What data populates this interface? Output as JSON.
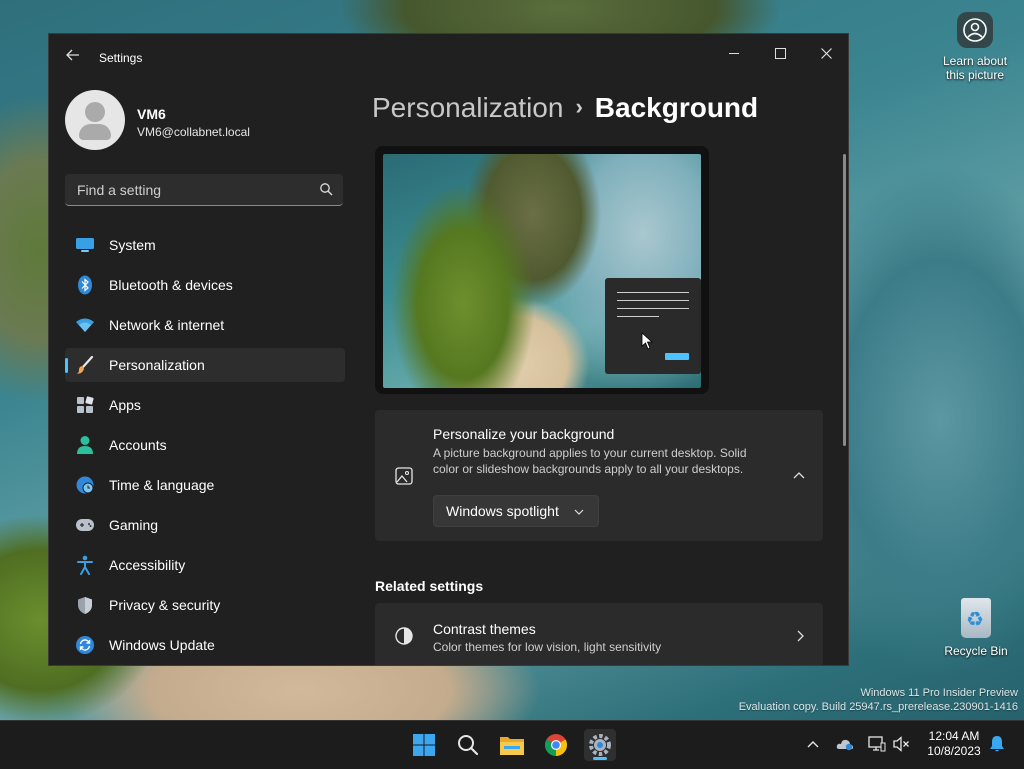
{
  "desktop": {
    "learn_label": "Learn about this picture",
    "recycle_label": "Recycle Bin",
    "watermark_line1": "Windows 11 Pro Insider Preview",
    "watermark_line2": "Evaluation copy. Build 25947.rs_prerelease.230901-1416"
  },
  "window": {
    "title": "Settings",
    "back_icon": "back-arrow-icon"
  },
  "profile": {
    "name": "VM6",
    "email": "VM6@collabnet.local"
  },
  "search": {
    "placeholder": "Find a setting"
  },
  "sidebar": {
    "items": [
      {
        "label": "System",
        "icon": "system-icon"
      },
      {
        "label": "Bluetooth & devices",
        "icon": "bluetooth-icon"
      },
      {
        "label": "Network & internet",
        "icon": "wifi-icon"
      },
      {
        "label": "Personalization",
        "icon": "brush-icon",
        "active": true
      },
      {
        "label": "Apps",
        "icon": "apps-icon"
      },
      {
        "label": "Accounts",
        "icon": "accounts-icon"
      },
      {
        "label": "Time & language",
        "icon": "globe-clock-icon"
      },
      {
        "label": "Gaming",
        "icon": "gamepad-icon"
      },
      {
        "label": "Accessibility",
        "icon": "accessibility-icon"
      },
      {
        "label": "Privacy & security",
        "icon": "shield-icon"
      },
      {
        "label": "Windows Update",
        "icon": "update-icon"
      }
    ]
  },
  "main": {
    "breadcrumb_parent": "Personalization",
    "breadcrumb_separator": "›",
    "breadcrumb_current": "Background",
    "personalize_card": {
      "title": "Personalize your background",
      "description": "A picture background applies to your current desktop. Solid color or slideshow backgrounds apply to all your desktops.",
      "dropdown_value": "Windows spotlight"
    },
    "related_heading": "Related settings",
    "contrast_card": {
      "title": "Contrast themes",
      "description": "Color themes for low vision, light sensitivity"
    }
  },
  "taskbar": {
    "apps": [
      "start-icon",
      "search-icon",
      "file-explorer-icon",
      "chrome-icon",
      "settings-icon"
    ],
    "time": "12:04 AM",
    "date": "10/8/2023"
  },
  "colors": {
    "accent": "#4cc2ff",
    "window_bg": "#202020",
    "card_bg": "#2b2b2b"
  }
}
